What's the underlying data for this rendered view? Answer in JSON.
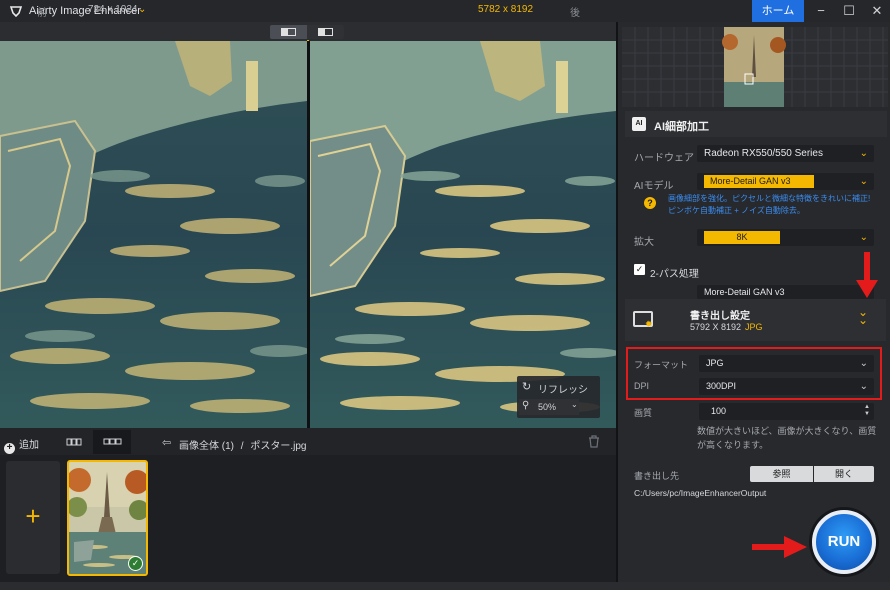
{
  "app": {
    "title": "Aiarty Image Enhancer",
    "home_label": "ホーム",
    "window_controls": {
      "minimize": "−",
      "maximize": "☐",
      "close": "✕"
    }
  },
  "viewer": {
    "before_label": "前",
    "after_label": "後",
    "original_res": "724 x 1024",
    "enhanced_res": "5782 x 8192",
    "refresh_label": "リフレッシュ",
    "zoom_value": "50%"
  },
  "files": {
    "add_label": "追加",
    "breadcrumb_all": "画像全体 (1)",
    "breadcrumb_sep": "/",
    "breadcrumb_file": "ポスター.jpg"
  },
  "panel": {
    "ai_section_title": "AI細部加工",
    "hardware_label": "ハードウェア",
    "hardware_value": "Radeon RX550/550 Series",
    "ai_model_label": "AIモデル",
    "ai_model_value": "More-Detail GAN  v3",
    "ai_model_help": "画像細部を強化。ピクセルと微細な特徴をきれいに補正!ピンボケ自動補正 + ノイズ自動除去。",
    "upscale_label": "拡大",
    "upscale_value": "8K",
    "two_pass_label": "2-パス処理",
    "two_pass_checked": true,
    "two_pass_model": "More-Detail GAN  v3",
    "export_title": "書き出し設定",
    "export_size": "5792 X 8192",
    "export_format_tag": "JPG",
    "format_label": "フォーマット",
    "format_value": "JPG",
    "dpi_label": "DPI",
    "dpi_value": "300DPI",
    "quality_label": "画質",
    "quality_value": "100",
    "quality_note": "数値が大きいほど、画像が大きくなり、画質が高くなります。",
    "output_label": "書き出し先",
    "browse_label": "参照",
    "open_label": "開く",
    "output_path": "C:/Users/pc/ImageEnhancerOutput",
    "run_label": "RUN"
  },
  "colors": {
    "accent": "#f5b800",
    "primary_blue": "#1f6fe0",
    "highlight_red": "#e31b1b"
  }
}
